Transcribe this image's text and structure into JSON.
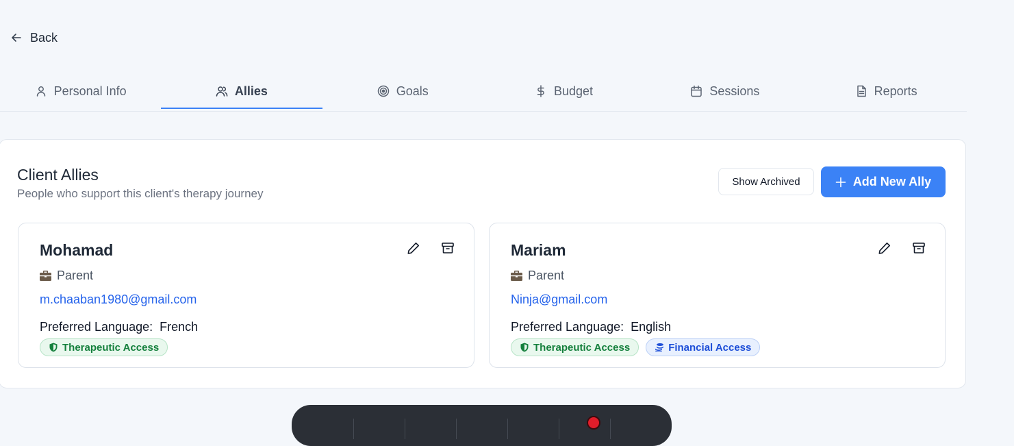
{
  "nav": {
    "back_label": "Back"
  },
  "tabs": [
    {
      "label": "Personal Info",
      "icon": "user-icon",
      "active": false
    },
    {
      "label": "Allies",
      "icon": "users-icon",
      "active": true
    },
    {
      "label": "Goals",
      "icon": "target-icon",
      "active": false
    },
    {
      "label": "Budget",
      "icon": "dollar-icon",
      "active": false
    },
    {
      "label": "Sessions",
      "icon": "calendar-icon",
      "active": false
    },
    {
      "label": "Reports",
      "icon": "document-icon",
      "active": false
    }
  ],
  "panel": {
    "title": "Client Allies",
    "subtitle": "People who support this client's therapy journey",
    "show_archived_label": "Show Archived",
    "add_label": "Add New Ally"
  },
  "allies": [
    {
      "name": "Mohamad",
      "role": "Parent",
      "email": "m.chaaban1980@gmail.com",
      "language_label": "Preferred Language:",
      "language": "French",
      "badges": [
        "Therapeutic Access"
      ]
    },
    {
      "name": "Mariam",
      "role": "Parent",
      "email": "Ninja@gmail.com",
      "language_label": "Preferred Language:",
      "language": "English",
      "badges": [
        "Therapeutic Access",
        "Financial Access"
      ]
    }
  ],
  "colors": {
    "accent": "#3b82f6",
    "link": "#2563eb",
    "therapeutic": "#15803d",
    "financial": "#1d4ed8",
    "recording": "#e11d2a"
  }
}
